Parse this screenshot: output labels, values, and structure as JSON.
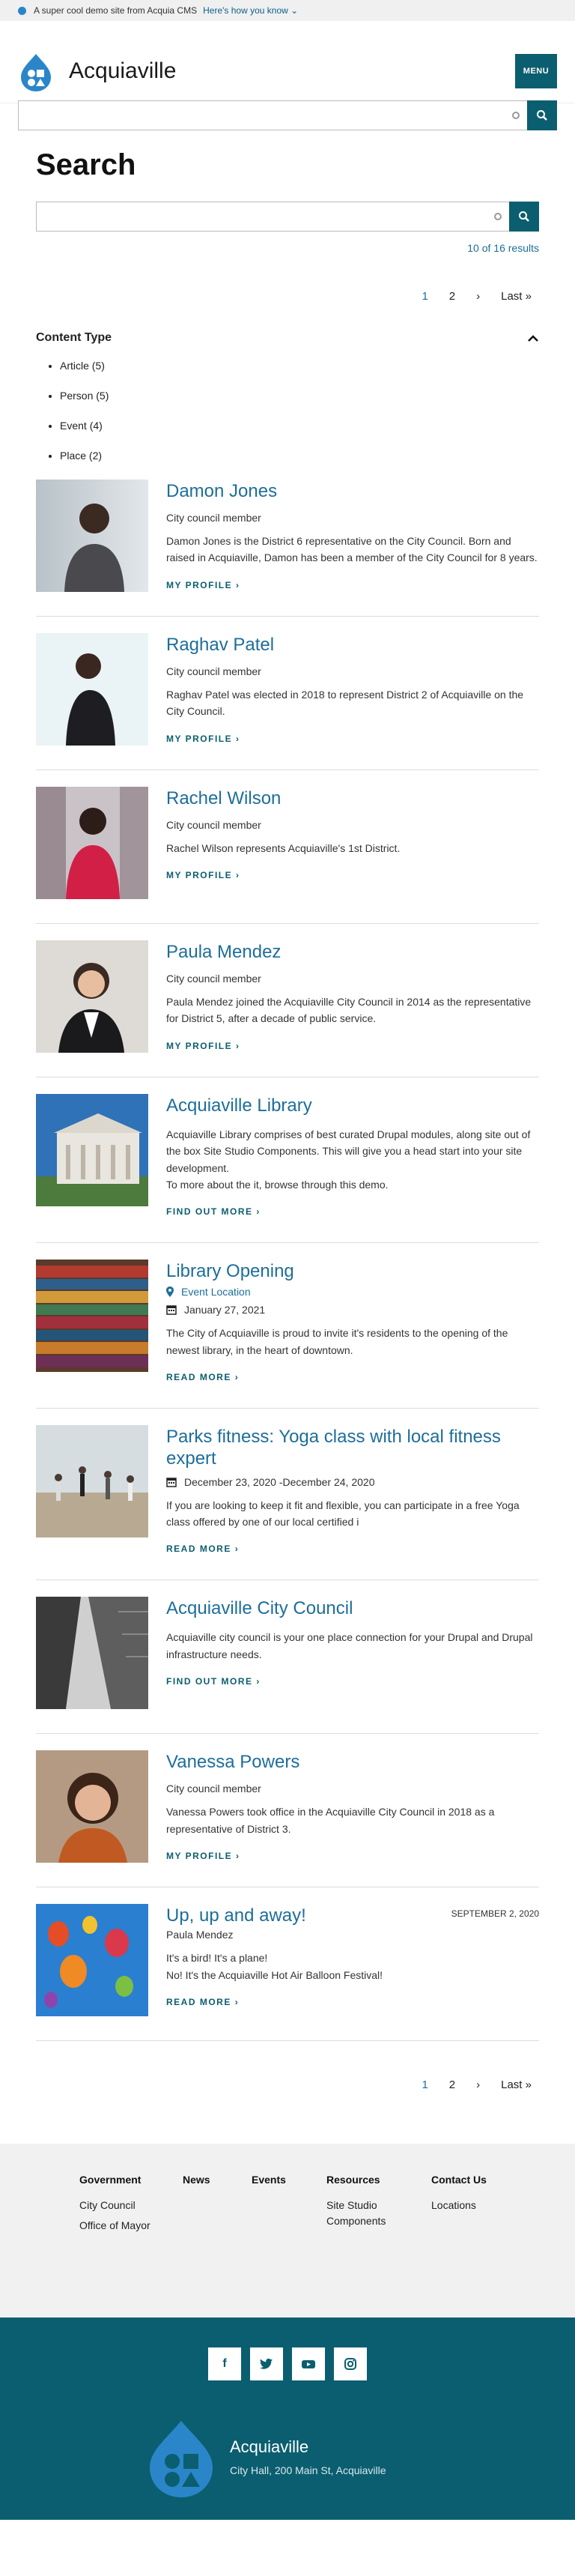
{
  "banner": {
    "text": "A super cool demo site from Acquia CMS",
    "link": "Here's how you know"
  },
  "header": {
    "site_name": "Acquiaville",
    "menu_label": "MENU"
  },
  "search": {
    "title": "Search",
    "results_text": "10 of 16 results"
  },
  "pager": {
    "current": "1",
    "page2": "2",
    "next": "›",
    "last": "Last »"
  },
  "facet": {
    "title": "Content Type",
    "items": [
      "Article (5)",
      "Person (5)",
      "Event (4)",
      "Place (2)"
    ]
  },
  "results": [
    {
      "title": "Damon Jones",
      "subtitle": "City council member",
      "text": "Damon Jones is the District 6 representative on the City Council. Born and raised in Acquiaville, Damon has been a member of the City Council for 8 years.",
      "link": "MY PROFILE"
    },
    {
      "title": "Raghav Patel",
      "subtitle": "City council member",
      "text": "Raghav Patel was elected in 2018 to represent District 2 of Acquiaville on the City Council.",
      "link": "MY PROFILE"
    },
    {
      "title": "Rachel Wilson",
      "subtitle": "City council member",
      "text": "Rachel Wilson represents Acquiaville's 1st District.",
      "link": "MY PROFILE"
    },
    {
      "title": "Paula Mendez",
      "subtitle": "City council member",
      "text": "Paula Mendez joined the Acquiaville City Council in 2014 as the representative for District 5, after a decade of public service.",
      "link": "MY PROFILE"
    },
    {
      "title": "Acquiaville Library",
      "text": "Acquiaville Library comprises of best curated Drupal modules, along site out of the box Site Studio Components. This will give you a head start into your site development.",
      "text2": "To more about the it, browse through this demo.",
      "link": "FIND OUT MORE"
    },
    {
      "title": "Library Opening",
      "location": "Event Location",
      "date": "January 27, 2021",
      "text": "The City of Acquiaville is proud to invite it's residents to the opening of the newest library, in the heart of downtown.",
      "link": "READ MORE"
    },
    {
      "title": "Parks fitness: Yoga class with local fitness expert",
      "date": "December 23, 2020 -December 24, 2020",
      "text": "If you are looking to keep it fit and flexible, you can participate in a free Yoga class offered by one of our local certified i",
      "link": "READ MORE"
    },
    {
      "title": "Acquiaville City Council",
      "text": "Acquiaville city council is your one place connection for your Drupal and Drupal infrastructure needs.",
      "link": "FIND OUT MORE"
    },
    {
      "title": "Vanessa Powers",
      "subtitle": "City council member",
      "text": "Vanessa Powers took office in the Acquiaville City Council in 2018 as a representative of District 3.",
      "link": "MY PROFILE"
    },
    {
      "title": "Up, up and away!",
      "author": "Paula Mendez",
      "published": "SEPTEMBER 2, 2020",
      "text": "It's a bird! It's a plane!",
      "text2": "No! It's the Acquiaville Hot Air Balloon Festival!",
      "link": "READ MORE"
    }
  ],
  "footer": {
    "columns": [
      {
        "title": "Government",
        "items": [
          "City Council",
          "Office of Mayor"
        ]
      },
      {
        "title": "News",
        "items": []
      },
      {
        "title": "Events",
        "items": []
      },
      {
        "title": "Resources",
        "items": [
          "Site Studio Components"
        ]
      },
      {
        "title": "Contact Us",
        "items": [
          "Locations"
        ]
      }
    ],
    "social_icons": [
      "facebook-icon",
      "twitter-icon",
      "youtube-icon",
      "instagram-icon"
    ],
    "site_name": "Acquiaville",
    "address": "City Hall, 200 Main St, Acquiaville"
  },
  "colors": {
    "brand": "#0b5e6f",
    "link": "#1d6e9a",
    "footer_bg": "#0b5e6f"
  }
}
